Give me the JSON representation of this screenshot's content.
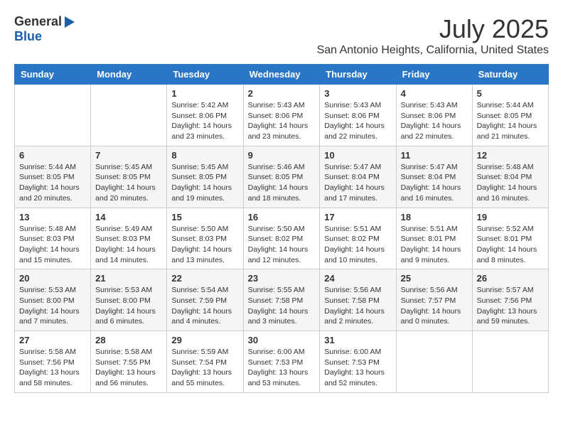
{
  "header": {
    "logo_general": "General",
    "logo_blue": "Blue",
    "month_year": "July 2025",
    "location": "San Antonio Heights, California, United States"
  },
  "days_of_week": [
    "Sunday",
    "Monday",
    "Tuesday",
    "Wednesday",
    "Thursday",
    "Friday",
    "Saturday"
  ],
  "weeks": [
    [
      {
        "day": "",
        "info": ""
      },
      {
        "day": "",
        "info": ""
      },
      {
        "day": "1",
        "info": "Sunrise: 5:42 AM\nSunset: 8:06 PM\nDaylight: 14 hours and 23 minutes."
      },
      {
        "day": "2",
        "info": "Sunrise: 5:43 AM\nSunset: 8:06 PM\nDaylight: 14 hours and 23 minutes."
      },
      {
        "day": "3",
        "info": "Sunrise: 5:43 AM\nSunset: 8:06 PM\nDaylight: 14 hours and 22 minutes."
      },
      {
        "day": "4",
        "info": "Sunrise: 5:43 AM\nSunset: 8:06 PM\nDaylight: 14 hours and 22 minutes."
      },
      {
        "day": "5",
        "info": "Sunrise: 5:44 AM\nSunset: 8:05 PM\nDaylight: 14 hours and 21 minutes."
      }
    ],
    [
      {
        "day": "6",
        "info": "Sunrise: 5:44 AM\nSunset: 8:05 PM\nDaylight: 14 hours and 20 minutes."
      },
      {
        "day": "7",
        "info": "Sunrise: 5:45 AM\nSunset: 8:05 PM\nDaylight: 14 hours and 20 minutes."
      },
      {
        "day": "8",
        "info": "Sunrise: 5:45 AM\nSunset: 8:05 PM\nDaylight: 14 hours and 19 minutes."
      },
      {
        "day": "9",
        "info": "Sunrise: 5:46 AM\nSunset: 8:05 PM\nDaylight: 14 hours and 18 minutes."
      },
      {
        "day": "10",
        "info": "Sunrise: 5:47 AM\nSunset: 8:04 PM\nDaylight: 14 hours and 17 minutes."
      },
      {
        "day": "11",
        "info": "Sunrise: 5:47 AM\nSunset: 8:04 PM\nDaylight: 14 hours and 16 minutes."
      },
      {
        "day": "12",
        "info": "Sunrise: 5:48 AM\nSunset: 8:04 PM\nDaylight: 14 hours and 16 minutes."
      }
    ],
    [
      {
        "day": "13",
        "info": "Sunrise: 5:48 AM\nSunset: 8:03 PM\nDaylight: 14 hours and 15 minutes."
      },
      {
        "day": "14",
        "info": "Sunrise: 5:49 AM\nSunset: 8:03 PM\nDaylight: 14 hours and 14 minutes."
      },
      {
        "day": "15",
        "info": "Sunrise: 5:50 AM\nSunset: 8:03 PM\nDaylight: 14 hours and 13 minutes."
      },
      {
        "day": "16",
        "info": "Sunrise: 5:50 AM\nSunset: 8:02 PM\nDaylight: 14 hours and 12 minutes."
      },
      {
        "day": "17",
        "info": "Sunrise: 5:51 AM\nSunset: 8:02 PM\nDaylight: 14 hours and 10 minutes."
      },
      {
        "day": "18",
        "info": "Sunrise: 5:51 AM\nSunset: 8:01 PM\nDaylight: 14 hours and 9 minutes."
      },
      {
        "day": "19",
        "info": "Sunrise: 5:52 AM\nSunset: 8:01 PM\nDaylight: 14 hours and 8 minutes."
      }
    ],
    [
      {
        "day": "20",
        "info": "Sunrise: 5:53 AM\nSunset: 8:00 PM\nDaylight: 14 hours and 7 minutes."
      },
      {
        "day": "21",
        "info": "Sunrise: 5:53 AM\nSunset: 8:00 PM\nDaylight: 14 hours and 6 minutes."
      },
      {
        "day": "22",
        "info": "Sunrise: 5:54 AM\nSunset: 7:59 PM\nDaylight: 14 hours and 4 minutes."
      },
      {
        "day": "23",
        "info": "Sunrise: 5:55 AM\nSunset: 7:58 PM\nDaylight: 14 hours and 3 minutes."
      },
      {
        "day": "24",
        "info": "Sunrise: 5:56 AM\nSunset: 7:58 PM\nDaylight: 14 hours and 2 minutes."
      },
      {
        "day": "25",
        "info": "Sunrise: 5:56 AM\nSunset: 7:57 PM\nDaylight: 14 hours and 0 minutes."
      },
      {
        "day": "26",
        "info": "Sunrise: 5:57 AM\nSunset: 7:56 PM\nDaylight: 13 hours and 59 minutes."
      }
    ],
    [
      {
        "day": "27",
        "info": "Sunrise: 5:58 AM\nSunset: 7:56 PM\nDaylight: 13 hours and 58 minutes."
      },
      {
        "day": "28",
        "info": "Sunrise: 5:58 AM\nSunset: 7:55 PM\nDaylight: 13 hours and 56 minutes."
      },
      {
        "day": "29",
        "info": "Sunrise: 5:59 AM\nSunset: 7:54 PM\nDaylight: 13 hours and 55 minutes."
      },
      {
        "day": "30",
        "info": "Sunrise: 6:00 AM\nSunset: 7:53 PM\nDaylight: 13 hours and 53 minutes."
      },
      {
        "day": "31",
        "info": "Sunrise: 6:00 AM\nSunset: 7:53 PM\nDaylight: 13 hours and 52 minutes."
      },
      {
        "day": "",
        "info": ""
      },
      {
        "day": "",
        "info": ""
      }
    ]
  ]
}
